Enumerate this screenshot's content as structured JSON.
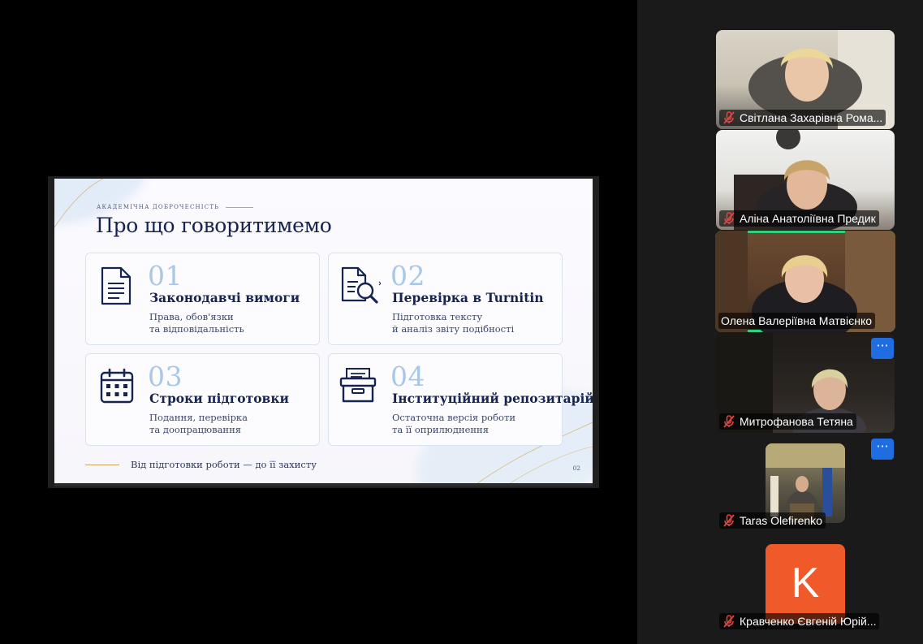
{
  "slide": {
    "eyebrow": "АКАДЕМІЧНА ДОБРОЧЕСНІСТЬ",
    "title": "Про що говоритимемо",
    "cards": [
      {
        "number": "01",
        "heading": "Законодавчі вимоги",
        "line1": "Права, обов'язки",
        "line2": "та відповідальність",
        "icon": "document-icon"
      },
      {
        "number": "02",
        "heading": "Перевірка в Turnitin",
        "line1": "Підготовка тексту",
        "line2": "й аналіз звіту подібності",
        "icon": "document-search-icon"
      },
      {
        "number": "03",
        "heading": "Строки підготовки",
        "line1": "Подання, перевірка",
        "line2": "та доопрацювання",
        "icon": "calendar-icon"
      },
      {
        "number": "04",
        "heading": "Інституційний репозитарій",
        "line1": "Остаточна версія роботи",
        "line2": "та її оприлюднення",
        "icon": "archive-box-icon"
      }
    ],
    "footer": "Від підготовки роботи — до її захисту",
    "page_number": "02",
    "colors": {
      "navy": "#16244f",
      "number_blue": "#a9c7e6",
      "gold": "#c9a562"
    }
  },
  "participants": [
    {
      "name": "Світлана Захарівна Рома...",
      "muted": true,
      "active": false
    },
    {
      "name": "Аліна Анатоліївна Предик",
      "muted": true,
      "active": false
    },
    {
      "name": "Олена Валеріївна Матвієнко",
      "muted": false,
      "active": true
    },
    {
      "name": "Митрофанова Тетяна",
      "muted": true,
      "active": false,
      "more_label": "···"
    },
    {
      "name": "Taras Olefirenko",
      "muted": true,
      "active": false,
      "more_label": "···"
    },
    {
      "name": "Кравченко Євгеній Юрій...",
      "muted": true,
      "active": false,
      "avatar_letter": "K",
      "avatar_color": "#f0592a"
    }
  ],
  "colors": {
    "active_border": "#2fd17a",
    "more_button": "#1f6de0",
    "muted_icon": "#e0443e"
  }
}
